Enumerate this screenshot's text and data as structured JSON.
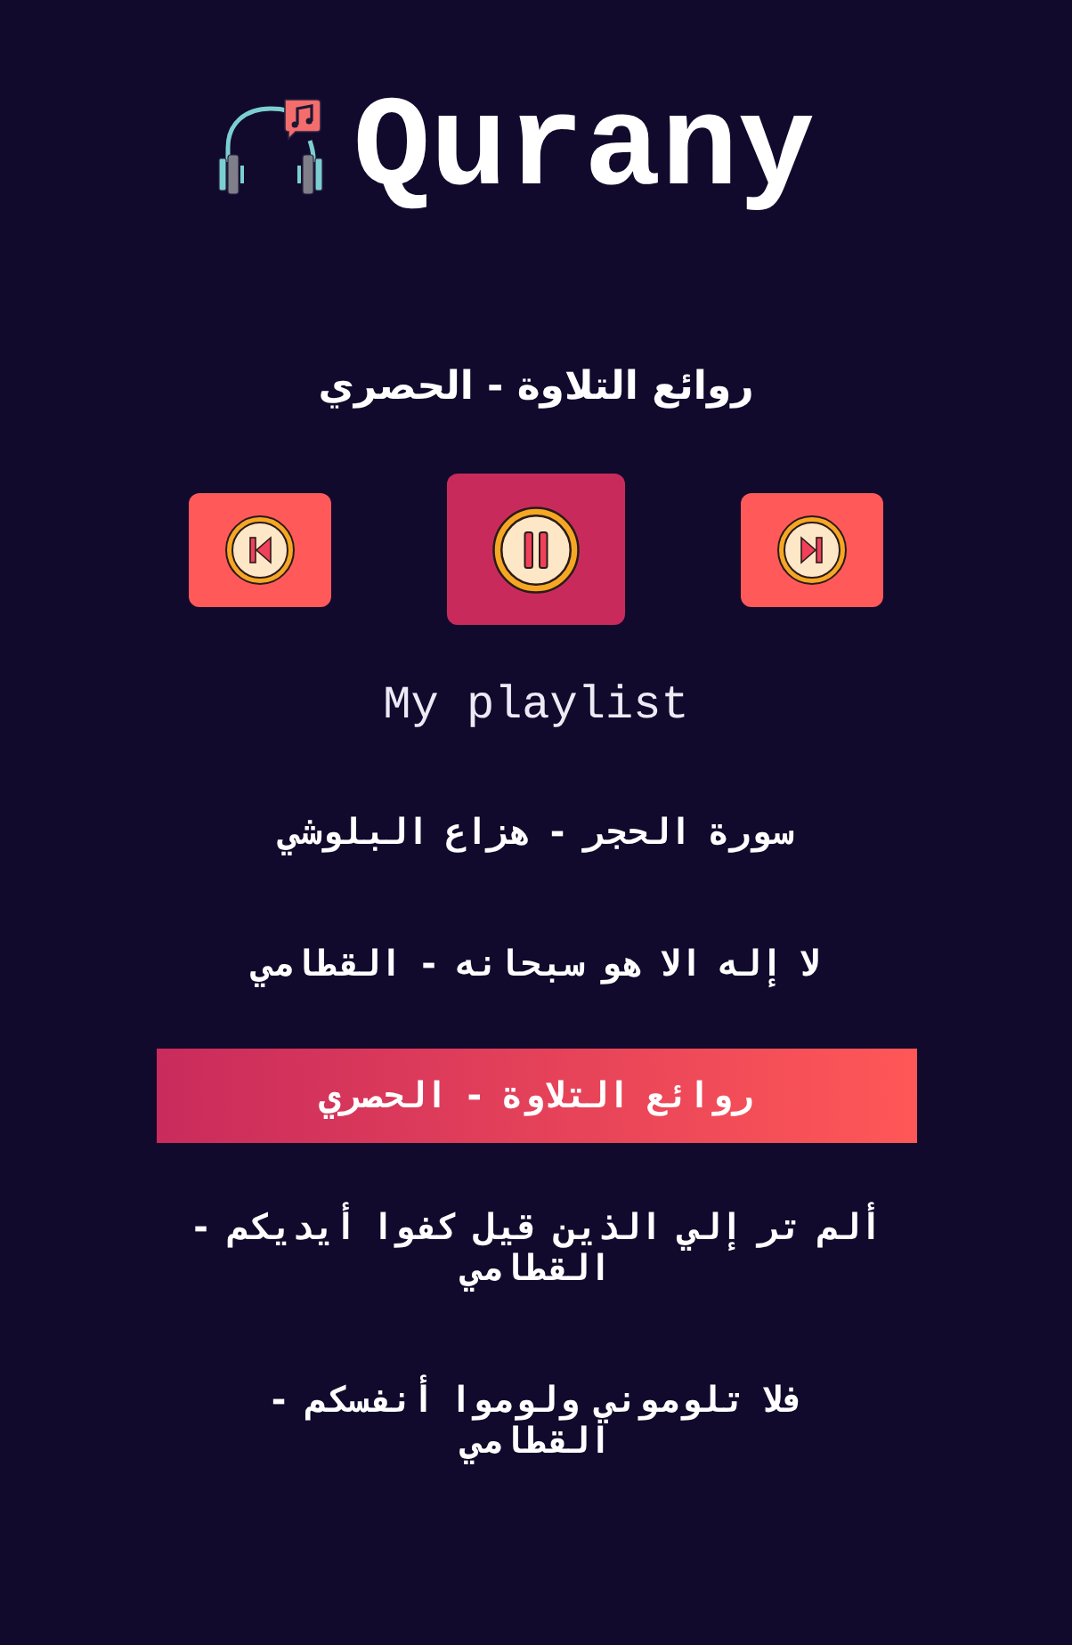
{
  "app": {
    "title": "Qurany"
  },
  "now_playing": {
    "title": "روائع التلاوة - الحصري"
  },
  "controls": {
    "playing": true
  },
  "playlist": {
    "title": "My playlist",
    "items": [
      {
        "title": "سورة الحجر - هزاع البلوشي",
        "selected": false
      },
      {
        "title": "لا إله الا هو سبحانه - القطامي",
        "selected": false
      },
      {
        "title": "روائع التلاوة - الحصري",
        "selected": true
      },
      {
        "title": "ألم تر إلي الذين قيل كفوا أيديكم - القطامي",
        "selected": false
      },
      {
        "title": "فلا تلوموني ولوموا أنفسكم - القطامي",
        "selected": false
      }
    ]
  }
}
